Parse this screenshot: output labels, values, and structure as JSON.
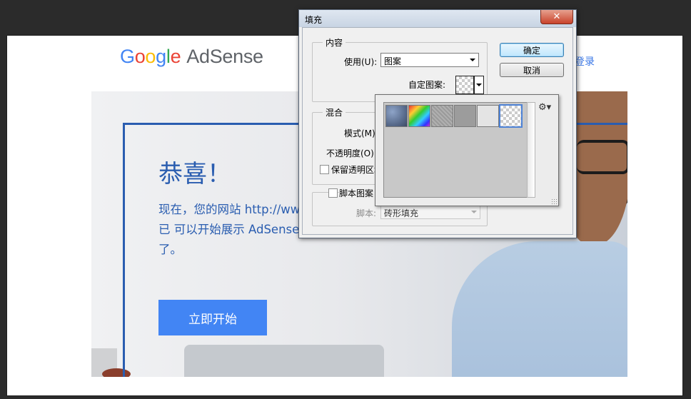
{
  "background_page": {
    "logo": {
      "google": [
        "G",
        "o",
        "o",
        "g",
        "l",
        "e"
      ],
      "adsense": "AdSense"
    },
    "signin_label": "登录",
    "hero": {
      "title": "恭喜！",
      "description": "现在，您的网站 http://www.vanhua.cn 已 可以开始展示 AdSense 广告为您创收 了。",
      "cta_label": "立即开始"
    }
  },
  "dialog": {
    "title": "填充",
    "close_glyph": "✕",
    "content_group": {
      "legend": "内容",
      "use_label": "使用(U):",
      "use_value": "图案",
      "custom_pattern_label": "自定图案:"
    },
    "blend_group": {
      "legend": "混合",
      "mode_label": "模式(M):",
      "opacity_label": "不透明度(O):",
      "preserve_label": "保留透明区域"
    },
    "script_group": {
      "checkbox_label": "脚本图案",
      "script_label": "脚本:",
      "script_value": "砖形填充"
    },
    "ok_label": "确定",
    "cancel_label": "取消"
  },
  "pattern_picker": {
    "gear_glyph": "⚙▾",
    "patterns": [
      "bubbles",
      "tie-dye",
      "gray-granite",
      "gray-solid",
      "light-noise",
      "transparent-checker"
    ],
    "selected_index": 5
  }
}
